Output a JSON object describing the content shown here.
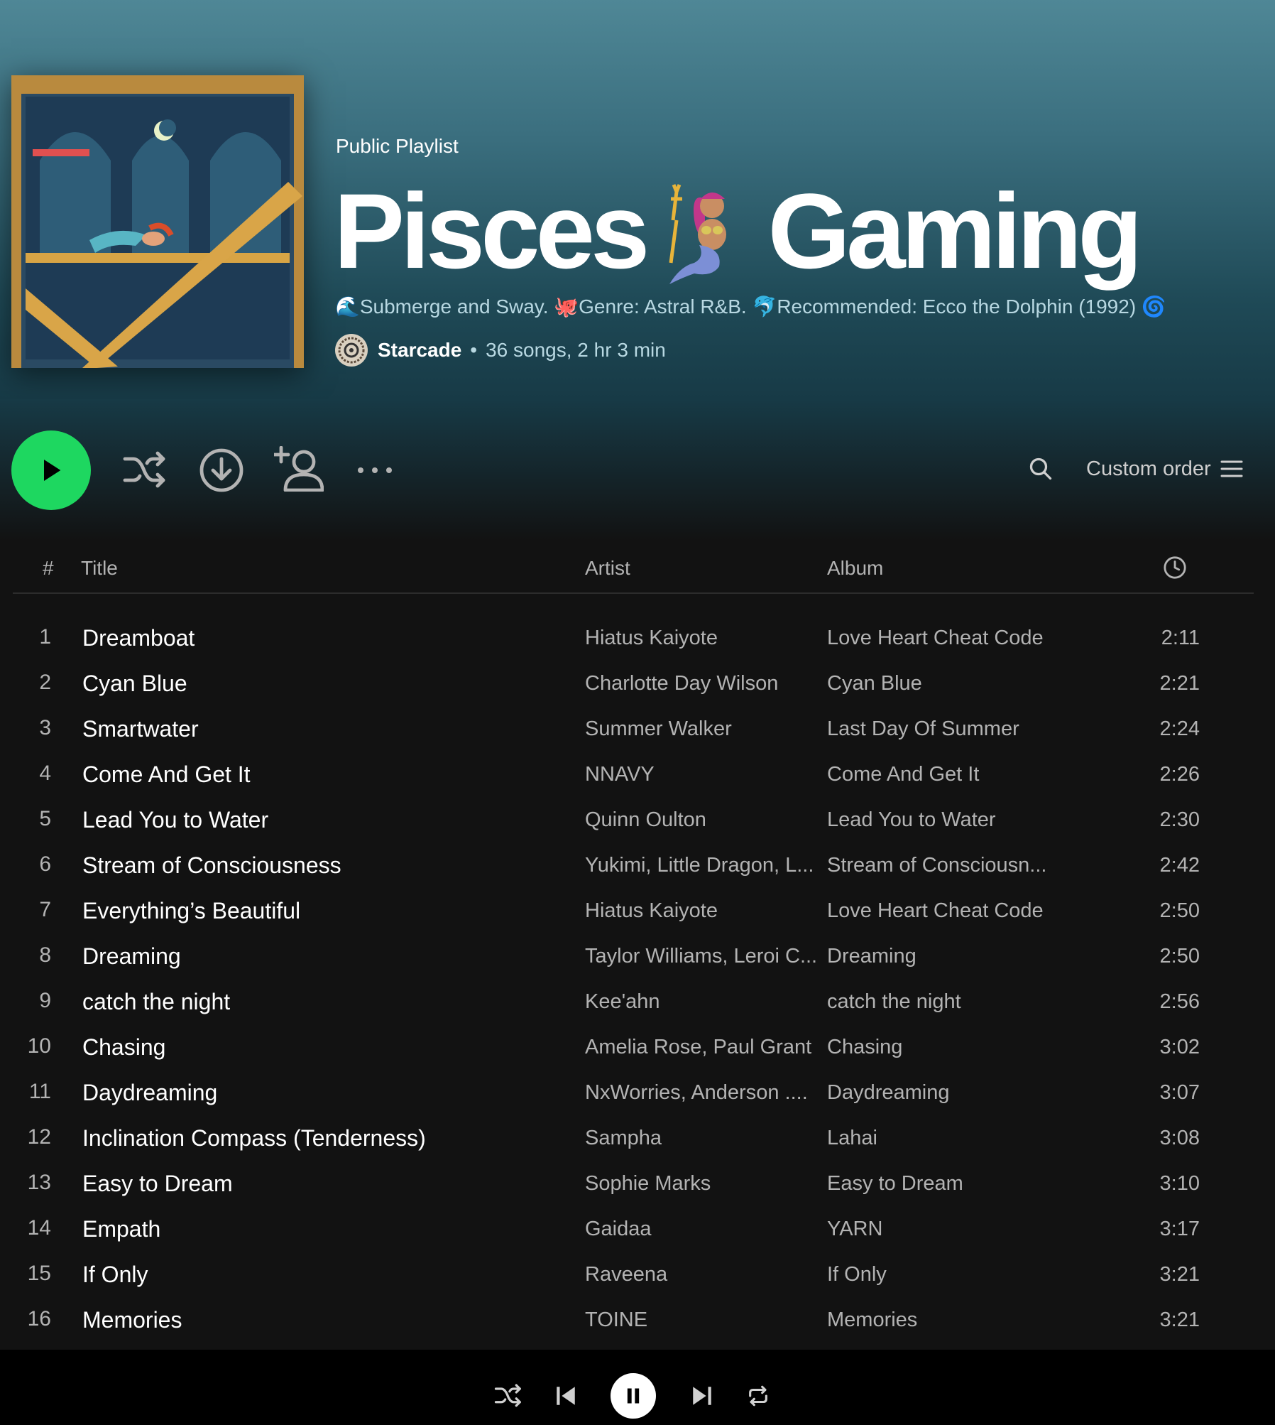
{
  "playlist": {
    "type_label": "Public Playlist",
    "title_part1": "Pisces",
    "title_part2": "Gaming",
    "description": "🌊Submerge and Sway. 🐙Genre: Astral R&B. 🐬Recommended: Ecco the Dolphin (1992) 🌀",
    "owner": "Starcade",
    "separator": "•",
    "summary": "36 songs, 2 hr 3 min"
  },
  "controls": {
    "sort_label": "Custom order"
  },
  "table": {
    "col_num": "#",
    "col_title": "Title",
    "col_artist": "Artist",
    "col_album": "Album"
  },
  "tracks": [
    {
      "num": "1",
      "title": "Dreamboat",
      "artist": "Hiatus Kaiyote",
      "album": "Love Heart Cheat Code",
      "duration": "2:11"
    },
    {
      "num": "2",
      "title": "Cyan Blue",
      "artist": "Charlotte Day Wilson",
      "album": "Cyan Blue",
      "duration": "2:21"
    },
    {
      "num": "3",
      "title": "Smartwater",
      "artist": "Summer Walker",
      "album": "Last Day Of Summer",
      "duration": "2:24"
    },
    {
      "num": "4",
      "title": "Come And Get It",
      "artist": "NNAVY",
      "album": "Come And Get It",
      "duration": "2:26"
    },
    {
      "num": "5",
      "title": "Lead You to Water",
      "artist": "Quinn Oulton",
      "album": "Lead You to Water",
      "duration": "2:30"
    },
    {
      "num": "6",
      "title": "Stream of Consciousness",
      "artist": "Yukimi, Little Dragon, L...",
      "album": "Stream of Consciousn...",
      "duration": "2:42"
    },
    {
      "num": "7",
      "title": "Everything’s Beautiful",
      "artist": "Hiatus Kaiyote",
      "album": "Love Heart Cheat Code",
      "duration": "2:50"
    },
    {
      "num": "8",
      "title": "Dreaming",
      "artist": "Taylor Williams, Leroi C...",
      "album": "Dreaming",
      "duration": "2:50"
    },
    {
      "num": "9",
      "title": "catch the night",
      "artist": "Kee'ahn",
      "album": "catch the night",
      "duration": "2:56"
    },
    {
      "num": "10",
      "title": "Chasing",
      "artist": "Amelia Rose, Paul Grant",
      "album": "Chasing",
      "duration": "3:02"
    },
    {
      "num": "11",
      "title": "Daydreaming",
      "artist": "NxWorries, Anderson ....",
      "album": "Daydreaming",
      "duration": "3:07"
    },
    {
      "num": "12",
      "title": "Inclination Compass (Tenderness)",
      "artist": "Sampha",
      "album": "Lahai",
      "duration": "3:08"
    },
    {
      "num": "13",
      "title": "Easy to Dream",
      "artist": "Sophie Marks",
      "album": "Easy to Dream",
      "duration": "3:10"
    },
    {
      "num": "14",
      "title": "Empath",
      "artist": "Gaidaa",
      "album": "YARN",
      "duration": "3:17"
    },
    {
      "num": "15",
      "title": "If Only",
      "artist": "Raveena",
      "album": "If Only",
      "duration": "3:21"
    },
    {
      "num": "16",
      "title": "Memories",
      "artist": "TOINE",
      "album": "Memories",
      "duration": "3:21"
    }
  ],
  "icons": {
    "play": "play-icon",
    "shuffle": "shuffle-icon",
    "download": "download-icon",
    "add_user": "add-user-icon",
    "more": "more-icon",
    "search": "search-icon",
    "list": "list-icon",
    "clock": "clock-icon",
    "prev": "previous-icon",
    "pause": "pause-icon",
    "next": "next-icon",
    "repeat": "repeat-icon"
  },
  "colors": {
    "accent": "#1ed760",
    "header_top": "#4f8796",
    "background": "#121212"
  }
}
